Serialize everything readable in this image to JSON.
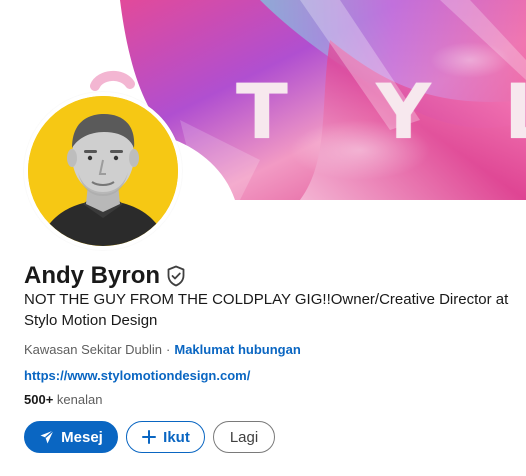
{
  "banner": {
    "letters": [
      "T",
      "Y",
      "L"
    ],
    "colors": {
      "magenta": "#d62f8c",
      "pink": "#f7b1d4",
      "violet": "#8b5bd8",
      "teal": "#3fb7c9"
    }
  },
  "profile": {
    "avatar_bg": "#f6c814",
    "name": "Andy Byron",
    "verified_icon": "verified-shield-icon",
    "headline": "NOT THE GUY FROM THE COLDPLAY GIG!!Owner/Creative Director at Stylo Motion Design",
    "location": "Kawasan Sekitar Dublin",
    "separator": "·",
    "contact_info": "Maklumat hubungan",
    "website": "https://www.stylomotiondesign.com/",
    "connections_count": "500+",
    "connections_label": "kenalan"
  },
  "actions": {
    "message_label": "Mesej",
    "message_icon": "send-icon",
    "follow_label": "Ikut",
    "follow_icon": "plus-icon",
    "more_label": "Lagi"
  },
  "colors": {
    "accent": "#0a66c2",
    "text": "#191919",
    "muted": "#5e5e5e"
  }
}
